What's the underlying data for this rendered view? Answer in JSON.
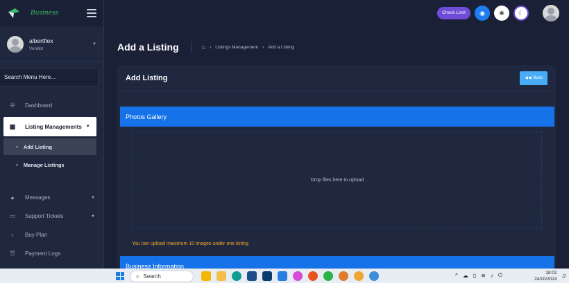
{
  "brand": {
    "name": "Business"
  },
  "user": {
    "name": "albertflex",
    "role": "Vendor"
  },
  "search": {
    "placeholder": "Search Menu Here..."
  },
  "menu": {
    "dashboard": "Dashboard",
    "listing_managements": "Listing Managements",
    "add_listing": "Add Listing",
    "manage_listings": "Manage Listings",
    "messages": "Messages",
    "support_tickets": "Support Tickets",
    "buy_plan": "Buy Plan",
    "payment_logs": "Payment Logs"
  },
  "topbar": {
    "check_limit": "Check Limit"
  },
  "page": {
    "title": "Add a Listing",
    "breadcrumb": [
      "Listings Management",
      "Add a Listing"
    ]
  },
  "card": {
    "title": "Add Listing",
    "back_label": "Back",
    "photos_section": "Photos Gallery",
    "dropzone_text": "Drop files here to upload",
    "upload_hint": "You can upload maximum 10 images under one listing",
    "business_section": "Business Information"
  },
  "taskbar": {
    "search_label": "Search",
    "time": "18:02",
    "date": "24/10/2024"
  },
  "colors": {
    "bg": "#1a2035",
    "sidebar": "#1f283e",
    "primary": "#1572e8",
    "accent_purple": "#6f4cd8",
    "hint": "#f5a623"
  }
}
